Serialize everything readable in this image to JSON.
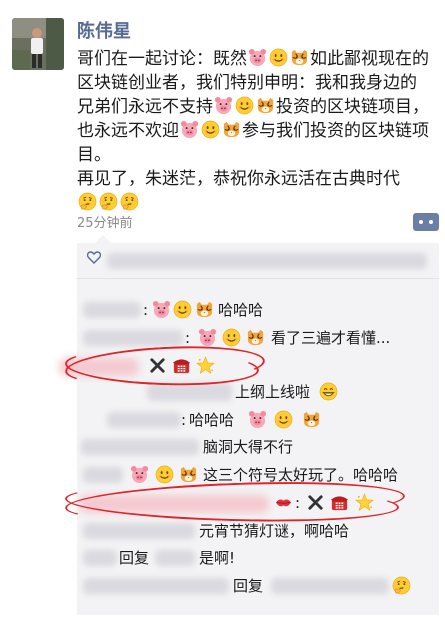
{
  "post": {
    "author": "陈伟星",
    "p1": "哥们在一起讨论：既然",
    "p2": "如此鄙视现在的区块链创业者，我们特别申明：我和我身边的兄弟们永远不支持",
    "p3": "投资的区块链项目，也永远不欢迎",
    "p4": "参与我们投资的区块链项目。",
    "p5": "再见了，朱迷茫，恭祝你永远活在古典时代",
    "time": "25分钟前"
  },
  "colors": {
    "name_blue": "#576b95",
    "panel": "#f3f3f5",
    "ellipse_red": "#e0242a"
  },
  "comments": [
    {
      "sep": ":",
      "text": "哈哈哈"
    },
    {
      "sep": ":",
      "text": "看了三遍才看懂..."
    },
    {
      "sep": "",
      "text": ""
    },
    {
      "sep": "",
      "text": "上纲上线啦"
    },
    {
      "sep": ":",
      "text": "哈哈哈"
    },
    {
      "sep": "",
      "text": "脑洞大得不行"
    },
    {
      "sep": "",
      "text": "这三个符号太好玩了。哈哈哈"
    },
    {
      "sep": ":",
      "text": ""
    },
    {
      "sep": "",
      "text": "元宵节猜灯谜，啊哈哈"
    },
    {
      "sep": "",
      "reply": "回复",
      "text": "是啊!"
    },
    {
      "sep": "",
      "reply": "回复",
      "text": ""
    }
  ]
}
